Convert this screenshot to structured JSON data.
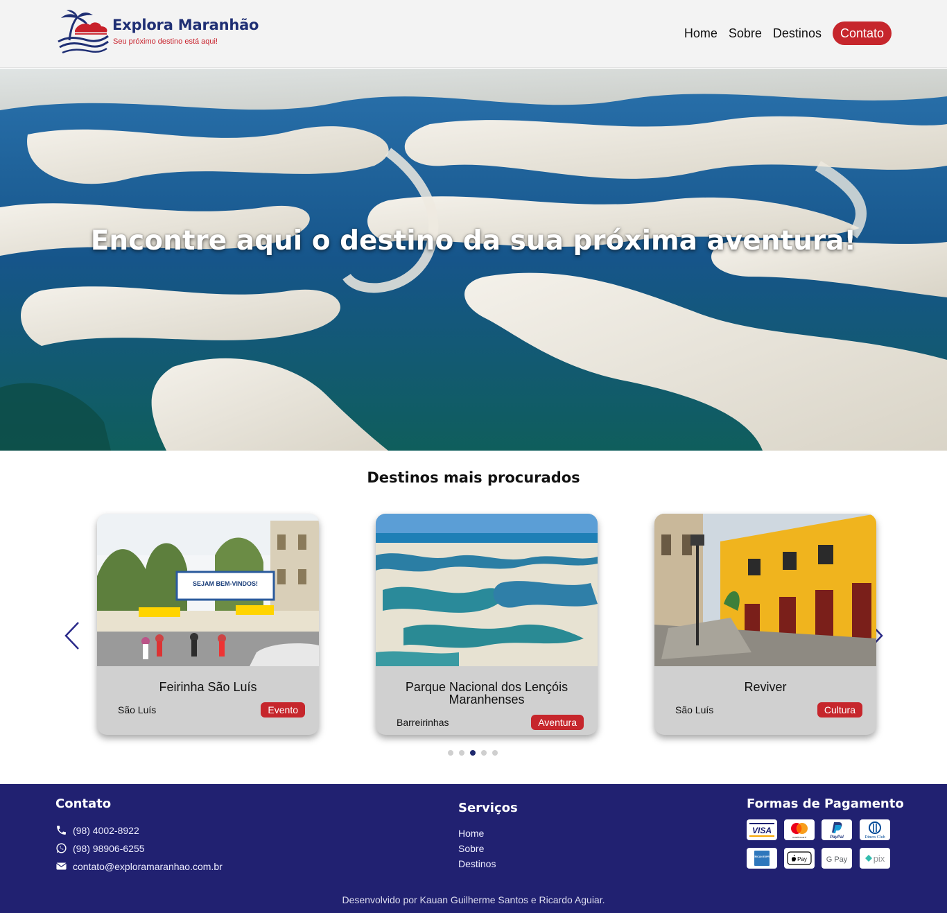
{
  "header": {
    "brand_title": "Explora Maranhão",
    "brand_tagline": "Seu próximo destino está aqui!",
    "nav": {
      "home": "Home",
      "about": "Sobre",
      "destinations": "Destinos",
      "contact": "Contato"
    },
    "colors": {
      "brand_navy": "#1f2f74",
      "accent_red": "#c6262c"
    }
  },
  "hero": {
    "title": "Encontre aqui o destino da sua próxima aventura!"
  },
  "destinations": {
    "title": "Destinos mais procurados",
    "cards": [
      {
        "name": "Feirinha São Luís",
        "city": "São Luís",
        "tag": "Evento",
        "banner_text": "SEJAM BEM-VINDOS!"
      },
      {
        "name": "Parque Nacional dos Lençóis Maranhenses",
        "city": "Barreirinhas",
        "tag": "Aventura"
      },
      {
        "name": "Reviver",
        "city": "São Luís",
        "tag": "Cultura"
      }
    ],
    "carousel": {
      "total_pages": 5,
      "active_page": 3,
      "prev_icon": "chevron-left-icon",
      "next_icon": "chevron-right-icon"
    }
  },
  "footer": {
    "contact": {
      "title": "Contato",
      "phone": "(98) 4002-8922",
      "whatsapp": "(98) 98906-6255",
      "email": "contato@exploramaranhao.com.br"
    },
    "services": {
      "title": "Serviços",
      "links": [
        "Home",
        "Sobre",
        "Destinos"
      ]
    },
    "payments": {
      "title": "Formas de Pagamento",
      "methods": [
        "VISA",
        "mastercard",
        "PayPal",
        "Diners Club",
        "AMERICAN EXPRESS",
        "Pay",
        "G Pay",
        "pix"
      ]
    },
    "credit": "Desenvolvido por Kauan Guilherme Santos e Ricardo Aguiar.",
    "colors": {
      "background": "#212171"
    }
  }
}
